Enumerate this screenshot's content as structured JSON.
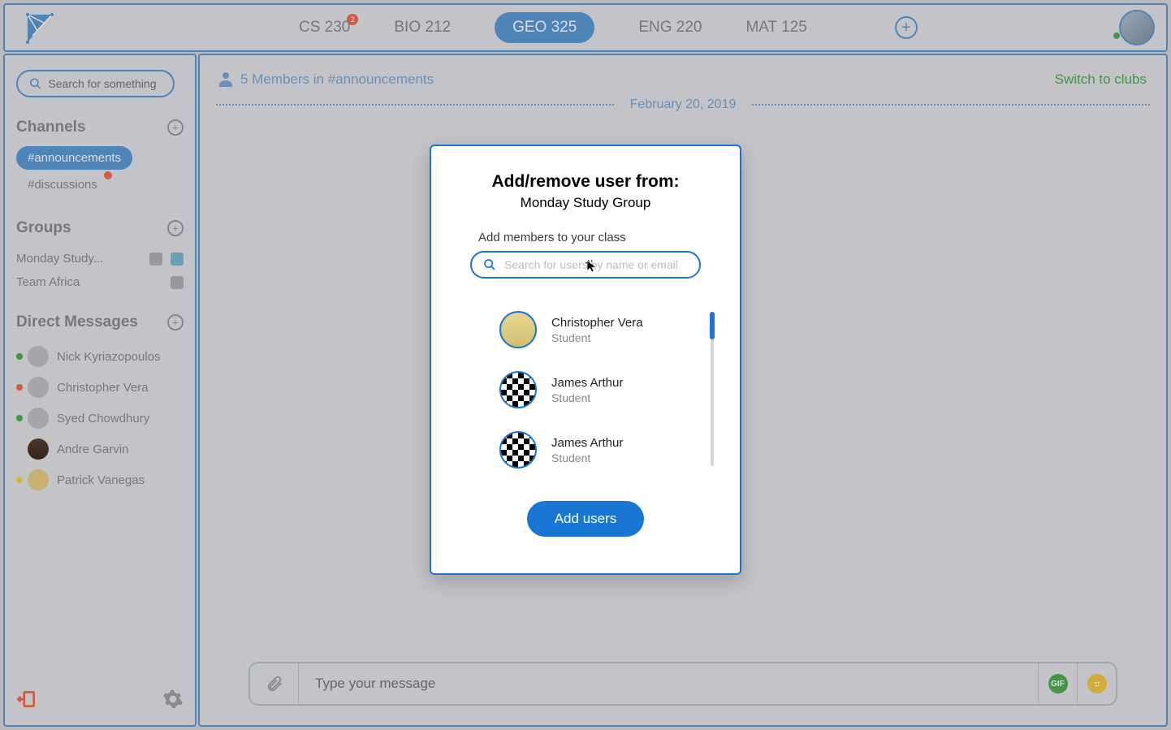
{
  "topbar": {
    "classes": [
      {
        "label": "CS 230",
        "badge": "2"
      },
      {
        "label": "BIO 212"
      },
      {
        "label": "GEO 325",
        "active": true
      },
      {
        "label": "ENG 220"
      },
      {
        "label": "MAT 125"
      }
    ]
  },
  "sidebar": {
    "search_placeholder": "Search for something",
    "channels_header": "Channels",
    "channels": [
      {
        "label": "#announcements",
        "active": true
      },
      {
        "label": "#discussions",
        "badge": true
      }
    ],
    "groups_header": "Groups",
    "groups": [
      {
        "label": "Monday Study..."
      },
      {
        "label": "Team Africa"
      }
    ],
    "dms_header": "Direct Messages",
    "dms": [
      {
        "name": "Nick Kyriazopoulos",
        "status": "#4caf50"
      },
      {
        "name": "Christopher Vera",
        "status": "#f26b4e"
      },
      {
        "name": "Syed Chowdhury",
        "status": "#4caf50"
      },
      {
        "name": "Andre Garvin",
        "status": null
      },
      {
        "name": "Patrick Vanegas",
        "status": "#f5d742"
      }
    ]
  },
  "main": {
    "member_text": "5 Members in #announcements",
    "switch_text": "Switch to clubs",
    "date": "February 20, 2019",
    "composer_placeholder": "Type your message",
    "gif_label": "GIF"
  },
  "modal": {
    "title": "Add/remove user from:",
    "subtitle": "Monday Study Group",
    "label": "Add members to your class",
    "search_placeholder": "Search for users by name or email",
    "users": [
      {
        "name": "Christopher Vera",
        "role": "Student"
      },
      {
        "name": "James Arthur",
        "role": "Student"
      },
      {
        "name": "James Arthur",
        "role": "Student"
      }
    ],
    "add_button": "Add users"
  }
}
